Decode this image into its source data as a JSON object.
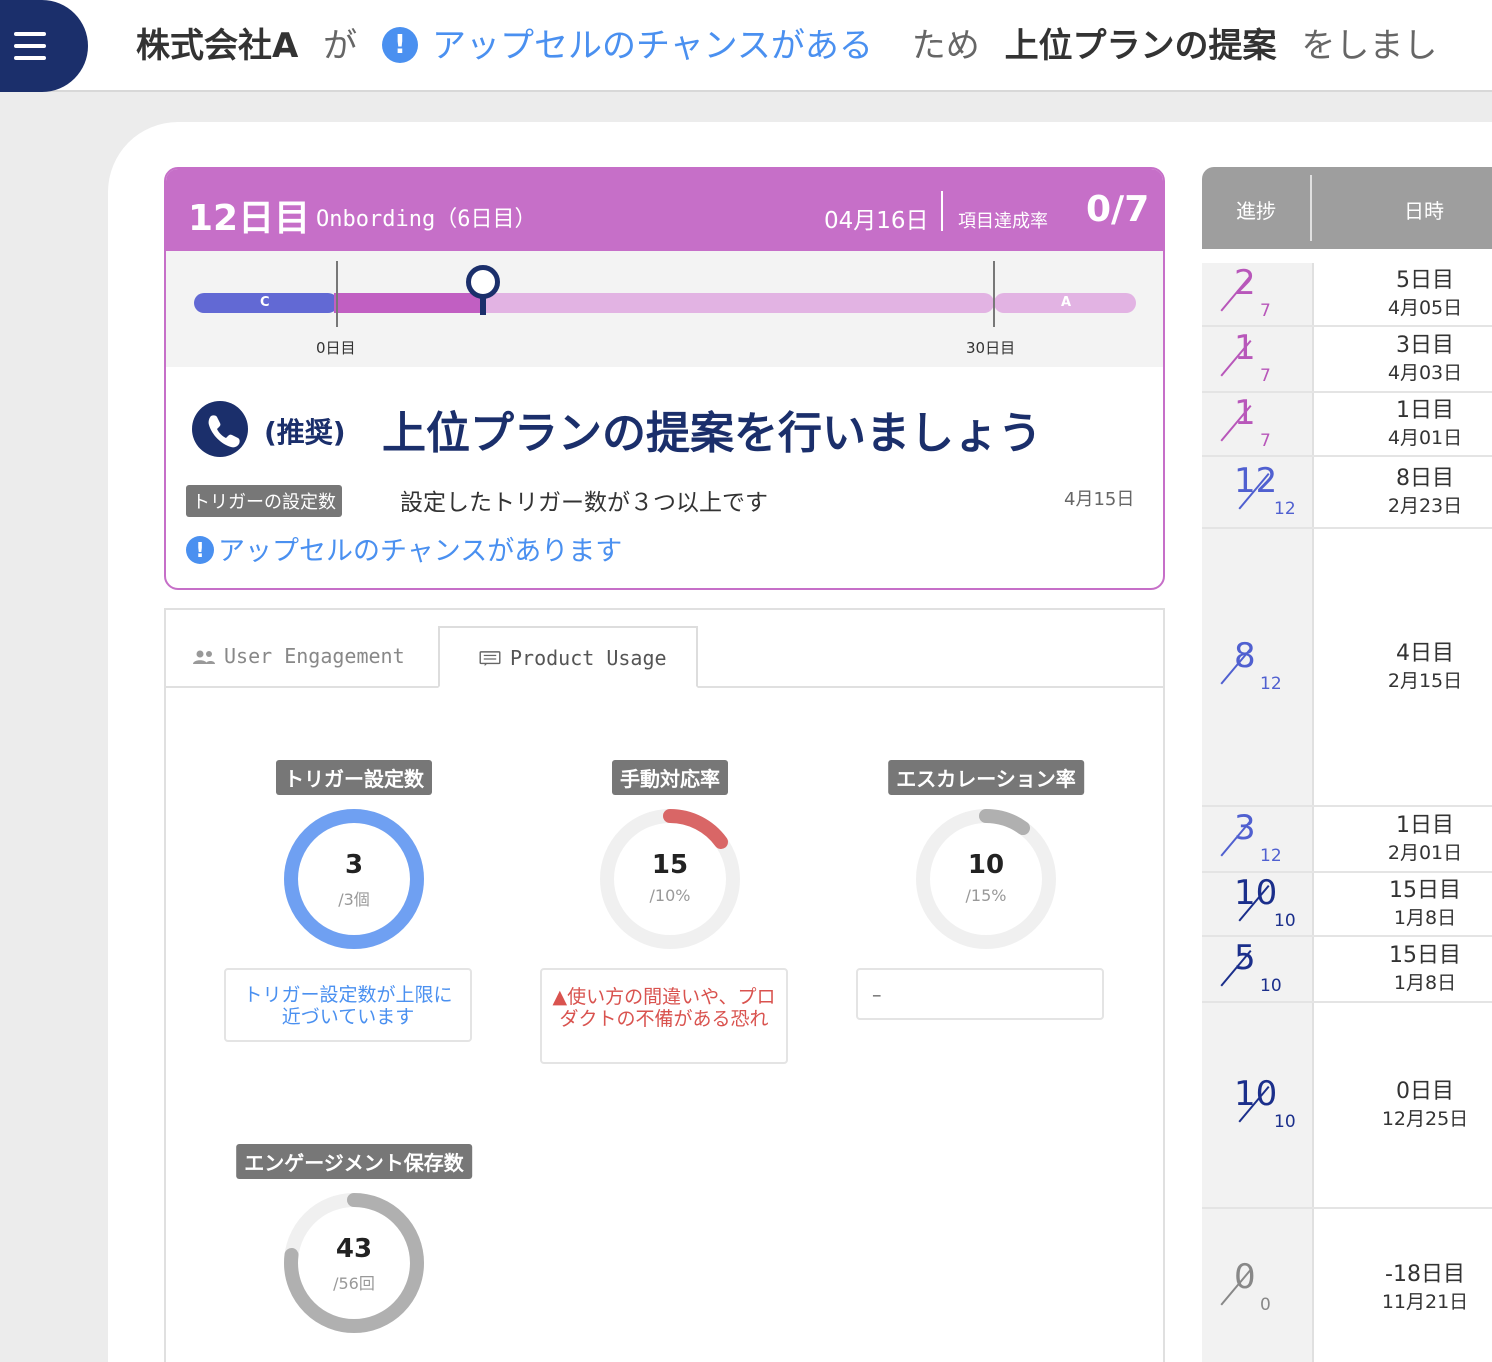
{
  "header": {
    "company": "株式会社A",
    "particle_ga": "が",
    "reason": "アップセルのチャンスがある",
    "particle_tame": "ため",
    "action": "上位プランの提案",
    "suffix": "をしまし"
  },
  "onboarding": {
    "day_label": "12日目",
    "phase_label": "Onbording（6日目）",
    "date": "04月16日",
    "rate_label": "項目達成率",
    "rate_value": "0/7",
    "segment_c": "C",
    "segment_a": "A",
    "tick_start": "0日目",
    "tick_end": "30日目",
    "progress_day": 12,
    "total_days": 30,
    "recommend_tag": "(推奨)",
    "recommend_title": "上位プランの提案を行いましょう",
    "trigger_badge": "トリガーの設定数",
    "trigger_desc": "設定したトリガー数が３つ以上です",
    "trigger_date": "4月15日",
    "upsell_text": "アップセルのチャンスがあります"
  },
  "tabs": [
    {
      "label": "User Engagement",
      "active": false
    },
    {
      "label": "Product Usage",
      "active": true
    }
  ],
  "metrics": [
    {
      "label": "トリガー設定数",
      "value": "3",
      "unit": "/3個",
      "fraction": 1.0,
      "color": "#6fa0f2",
      "note": "トリガー設定数が上限に近づいています"
    },
    {
      "label": "手動対応率",
      "value": "15",
      "unit": "/10%",
      "fraction": 0.15,
      "color": "#d96666",
      "note": "使い方の間違いや、プロダクトの不備がある恐れ"
    },
    {
      "label": "エスカレーション率",
      "value": "10",
      "unit": "/15%",
      "fraction": 0.1,
      "color": "#b0b0b0",
      "note": "–"
    },
    {
      "label": "エンゲージメント保存数",
      "value": "43",
      "unit": "/56回",
      "fraction": 0.77,
      "color": "#b0b0b0"
    }
  ],
  "history": {
    "head_progress": "進捗",
    "head_date": "日時",
    "rows": [
      {
        "num": "2",
        "den": "7",
        "day": "5日目",
        "date": "4月05日",
        "color": "purple"
      },
      {
        "num": "1",
        "den": "7",
        "day": "3日目",
        "date": "4月03日",
        "color": "purple"
      },
      {
        "num": "1",
        "den": "7",
        "day": "1日目",
        "date": "4月01日",
        "color": "purple"
      },
      {
        "num": "12",
        "den": "12",
        "day": "8日目",
        "date": "2月23日",
        "color": "blue"
      },
      {
        "num": "8",
        "den": "12",
        "day": "4日目",
        "date": "2月15日",
        "color": "blue"
      },
      {
        "num": "3",
        "den": "12",
        "day": "1日目",
        "date": "2月01日",
        "color": "blue"
      },
      {
        "num": "10",
        "den": "10",
        "day": "15日目",
        "date": "1月8日",
        "color": "navy"
      },
      {
        "num": "5",
        "den": "10",
        "day": "15日目",
        "date": "1月8日",
        "color": "navy"
      },
      {
        "num": "10",
        "den": "10",
        "day": "0日目",
        "date": "12月25日",
        "color": "navy"
      },
      {
        "num": "0",
        "den": "0",
        "day": "-18日目",
        "date": "11月21日",
        "color": "gray"
      }
    ]
  }
}
